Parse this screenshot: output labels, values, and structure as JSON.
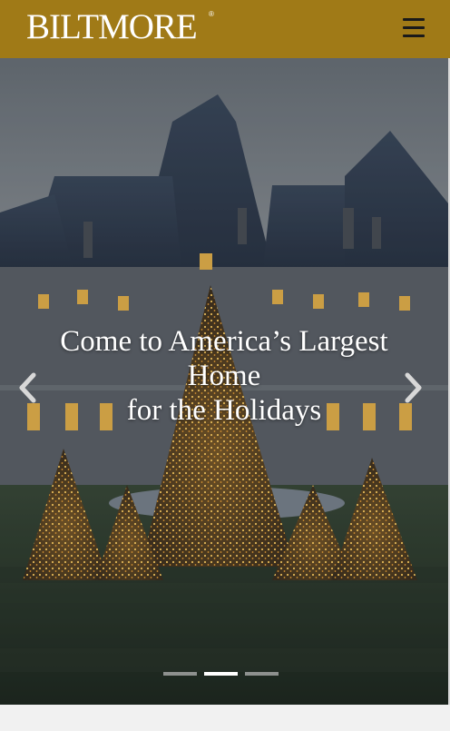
{
  "header": {
    "logo_text": "BILTMORE",
    "logo_mark": "®",
    "menu_icon": "hamburger-menu-icon",
    "background": "#a07a17"
  },
  "hero": {
    "headline_line1": "Come to America’s Largest",
    "headline_line2": "Home",
    "headline_line3": "for the Holidays",
    "prev_icon": "chevron-left-icon",
    "next_icon": "chevron-right-icon",
    "slide_count": 3,
    "active_slide": 2
  },
  "colors": {
    "accent": "#a07a17",
    "headline": "#ffffff",
    "lights": "#f2b43c"
  }
}
